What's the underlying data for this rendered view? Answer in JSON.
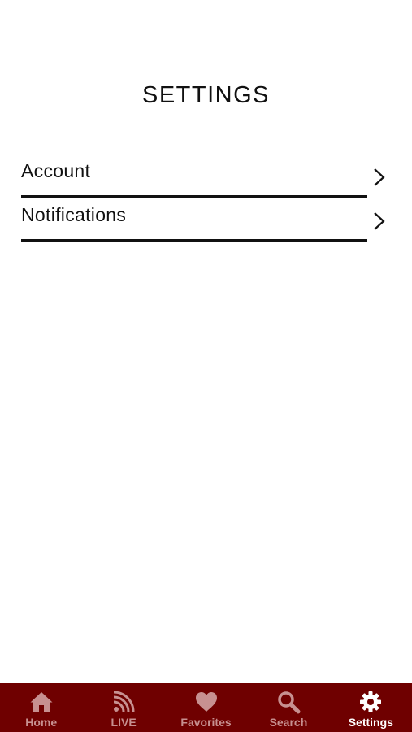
{
  "header": {
    "title": "SETTINGS"
  },
  "settings": {
    "items": [
      {
        "label": "Account"
      },
      {
        "label": "Notifications"
      }
    ]
  },
  "tab_bar": {
    "background": "#6f0000",
    "active_color": "#ffffff",
    "inactive_color": "#c79090",
    "tabs": [
      {
        "label": "Home",
        "icon": "home-icon",
        "active": false
      },
      {
        "label": "LIVE",
        "icon": "rss-icon",
        "active": false
      },
      {
        "label": "Favorites",
        "icon": "heart-icon",
        "active": false
      },
      {
        "label": "Search",
        "icon": "search-icon",
        "active": false
      },
      {
        "label": "Settings",
        "icon": "gear-icon",
        "active": true
      }
    ]
  }
}
